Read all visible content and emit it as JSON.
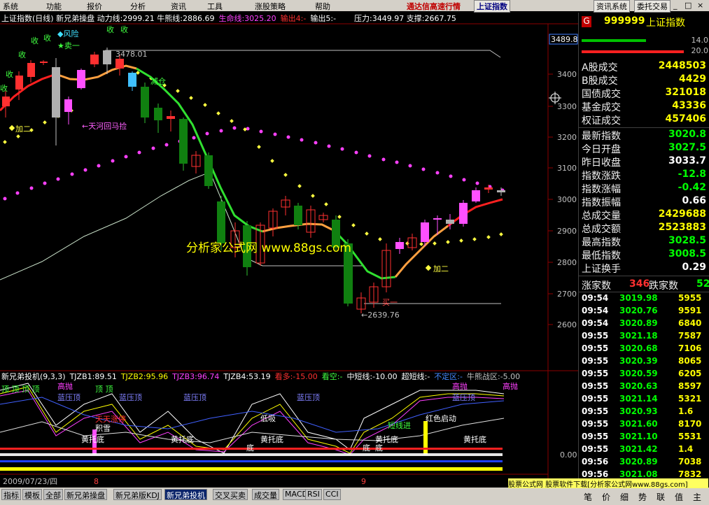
{
  "menubar": {
    "items": [
      "系统",
      "功能",
      "报价",
      "分析",
      "资讯",
      "工具",
      "涨股策略",
      "帮助"
    ],
    "title": "通达信高速行情",
    "market_name": "上证指数",
    "buttons": [
      "资讯系统",
      "委托交易"
    ],
    "window_controls": [
      "_",
      "□",
      "×"
    ]
  },
  "chart": {
    "info_line": [
      {
        "text": "上证指数(日线) 新兄弟操盘 动力线:2999.21 牛熊线:2886.69",
        "color": "#ffffff"
      },
      {
        "text": "生命线:3025.20",
        "color": "#ff00ff"
      },
      {
        "text": "输出4:-",
        "color": "#ff3030"
      },
      {
        "text": "输出5:-",
        "color": "#ffffff"
      },
      {
        "text": "压力:3449.97 支撑:2667.75",
        "color": "#ffffff"
      }
    ],
    "price_axis": [
      "3400",
      "3300",
      "3200",
      "3100",
      "3000",
      "2900",
      "2800",
      "2700",
      "2600"
    ],
    "price_tag": "3489.8",
    "annotations": {
      "fengxian": "◆风险",
      "maiyi": "★卖一",
      "shou1": "收",
      "shou2": "收",
      "shou3": "收",
      "shou4": "收",
      "shou5": "收",
      "shou6": "收",
      "shou7": "收",
      "jiaer1": "加二",
      "jiaer2": "加二",
      "tianhe": "←天河回马捡",
      "jiancang": "减仓",
      "high": "3478.01",
      "low": "←2639.76",
      "maiyi_bottom": "买一",
      "watermark": "分析家公式网 www.88gs.com"
    },
    "indicator": {
      "info_line": [
        {
          "text": "新兄弟投机(9,3,3)",
          "color": "#ffffff"
        },
        {
          "text": "TJZB1:89.51",
          "color": "#ffffff"
        },
        {
          "text": "TJZB2:95.96",
          "color": "#ffff00"
        },
        {
          "text": "TJZB3:96.74",
          "color": "#ff00ff"
        },
        {
          "text": "TJZB4:53.19",
          "color": "#ffffff"
        },
        {
          "text": "看多:-15.00",
          "color": "#ff3030"
        },
        {
          "text": "看空:-",
          "color": "#00ff00"
        },
        {
          "text": "中短线:-10.00",
          "color": "#ffffff"
        },
        {
          "text": "超短线:-",
          "color": "#ffffff"
        },
        {
          "text": "不定区:-",
          "color": "#4488ff"
        },
        {
          "text": "牛熊战区:-5.00",
          "color": "#c0c0c0"
        }
      ],
      "axis_zero": "0.00",
      "labels": {
        "ding": "顶 顶 顶 顶",
        "ding2": "顶 顶",
        "gaopao1": "高抛",
        "gaopao2": "高抛",
        "gaopao3": "高抛",
        "lanyading1": "蓝压顶",
        "lanyading2": "蓝压顶",
        "lanyading3": "蓝压顶",
        "lanyading4": "蓝压顶",
        "lanyading5": "蓝压顶",
        "tiantian": "天天涨停",
        "jixue": "积雪",
        "diji": "低吸",
        "duanxian": "短线进",
        "hongse": "红色启动",
        "huangtuodi1": "黄托底",
        "huangtuodi2": "黄托底",
        "huangtuodi3": "黄托底",
        "huangtuodi4": "黄托底",
        "huangtuodi5": "黄托底",
        "di1": "底",
        "di2": "底",
        "di3": "底"
      }
    },
    "date_label": "2009/07/23/四",
    "month_marks": [
      "8",
      "9"
    ]
  },
  "right_panel": {
    "code": "999999",
    "name": "上证指数",
    "badge": "G",
    "bar_values": [
      "14.0",
      "20.0"
    ],
    "stats": [
      {
        "label": "A股成交",
        "value": "2448503",
        "color": "#ffff00"
      },
      {
        "label": "B股成交",
        "value": "4429",
        "color": "#ffff00"
      },
      {
        "label": "国债成交",
        "value": "321018",
        "color": "#ffff00"
      },
      {
        "label": "基金成交",
        "value": "43336",
        "color": "#ffff00"
      },
      {
        "label": "权证成交",
        "value": "457406",
        "color": "#ffff00"
      },
      {
        "label": "最新指数",
        "value": "3020.8",
        "color": "#00ff00"
      },
      {
        "label": "今日开盘",
        "value": "3027.5",
        "color": "#00ff00"
      },
      {
        "label": "昨日收盘",
        "value": "3033.7",
        "color": "#ffffff"
      },
      {
        "label": "指数涨跌",
        "value": "-12.8",
        "color": "#00ff00"
      },
      {
        "label": "指数涨幅",
        "value": "-0.42",
        "color": "#00ff00"
      },
      {
        "label": "指数振幅",
        "value": "0.66",
        "color": "#ffffff"
      },
      {
        "label": "总成交量",
        "value": "2429688",
        "color": "#ffff00"
      },
      {
        "label": "总成交额",
        "value": "2523883",
        "color": "#ffff00"
      },
      {
        "label": "最高指数",
        "value": "3028.5",
        "color": "#00ff00"
      },
      {
        "label": "最低指数",
        "value": "3008.5",
        "color": "#00ff00"
      },
      {
        "label": "上证换手",
        "value": "0.29",
        "color": "#ffffff"
      }
    ],
    "rise_label": "涨家数",
    "rise_value": "346",
    "fall_label": "跌家数",
    "fall_value": "52",
    "ticks": [
      {
        "time": "09:54",
        "price": "3019.98",
        "vol": "5955"
      },
      {
        "time": "09:54",
        "price": "3020.76",
        "vol": "9591"
      },
      {
        "time": "09:54",
        "price": "3020.89",
        "vol": "6840"
      },
      {
        "time": "09:55",
        "price": "3021.18",
        "vol": "7587"
      },
      {
        "time": "09:55",
        "price": "3020.68",
        "vol": "7106"
      },
      {
        "time": "09:55",
        "price": "3020.39",
        "vol": "8065"
      },
      {
        "time": "09:55",
        "price": "3020.59",
        "vol": "6205"
      },
      {
        "time": "09:55",
        "price": "3020.63",
        "vol": "8597"
      },
      {
        "time": "09:55",
        "price": "3021.14",
        "vol": "5321"
      },
      {
        "time": "09:55",
        "price": "3020.93",
        "vol": "1.6"
      },
      {
        "time": "09:55",
        "price": "3021.60",
        "vol": "8170"
      },
      {
        "time": "09:55",
        "price": "3021.10",
        "vol": "5531"
      },
      {
        "time": "09:55",
        "price": "3021.42",
        "vol": "1.4"
      },
      {
        "time": "09:56",
        "price": "3020.89",
        "vol": "7038"
      },
      {
        "time": "09:56",
        "price": "3021.08",
        "vol": "7832"
      }
    ]
  },
  "bottom": {
    "tabs": [
      "指标",
      "模板",
      "全部",
      "新兄弟操盘",
      "新兄弟版KDJ",
      "新兄弟投机",
      "交叉买卖",
      "成交量",
      "MACD",
      "RSI",
      "CCI"
    ],
    "active_tab": "新兄弟投机",
    "ad": "股票公式网 股票软件下载[分析家公式网www.88gs.com]",
    "status": [
      "笔",
      "价",
      "细",
      "势",
      "联",
      "值",
      "主"
    ]
  },
  "colors": {
    "up": "#ff0000",
    "down": "#00ff00",
    "magenta": "#ff40ff",
    "yellow": "#ffff00",
    "orange": "#ffa040"
  }
}
